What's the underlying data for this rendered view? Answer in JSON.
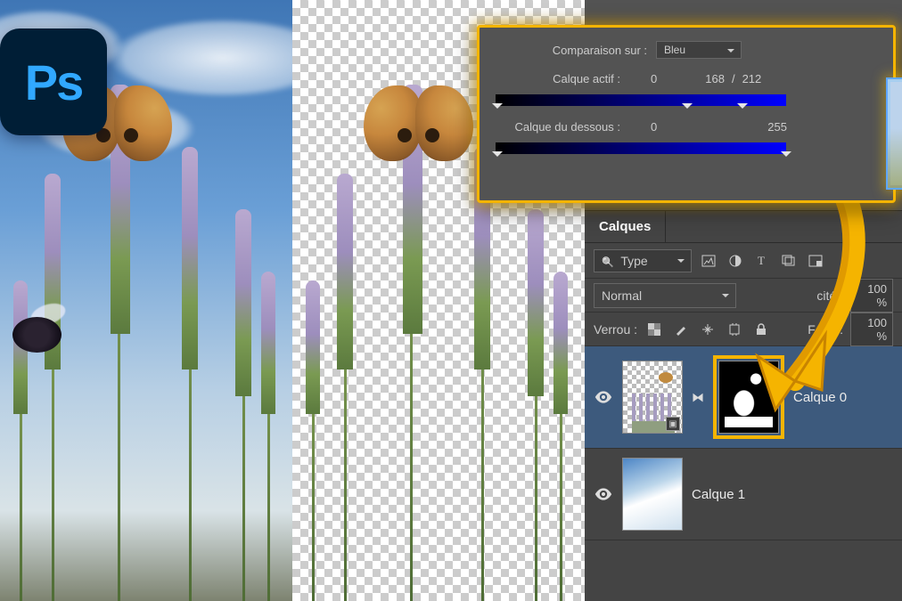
{
  "app": {
    "name": "Ps"
  },
  "blendif": {
    "compare_label": "Comparaison sur :",
    "compare_value": "Bleu",
    "this_layer_label": "Calque actif :",
    "this_layer_low": "0",
    "this_layer_mid": "168",
    "this_layer_sep": "/",
    "this_layer_high": "212",
    "under_layer_label": "Calque du dessous :",
    "under_layer_low": "0",
    "under_layer_high": "255"
  },
  "layers_panel": {
    "title": "Calques",
    "filter_label": "Type",
    "blend_mode": "Normal",
    "opacity_label": "cité :",
    "opacity_value": "100 %",
    "lock_label": "Verrou :",
    "fill_label": "Fond :",
    "fill_value": "100 %",
    "layers": [
      {
        "name": "Calque 0",
        "visible": true,
        "active": true,
        "has_mask": true
      },
      {
        "name": "Calque 1",
        "visible": true,
        "active": false,
        "has_mask": false
      }
    ]
  }
}
